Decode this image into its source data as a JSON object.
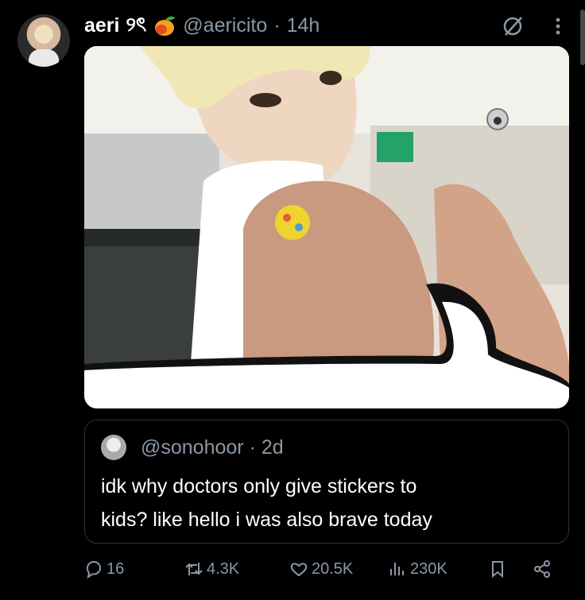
{
  "post": {
    "display_name": "aeri",
    "name_suffix": "୨ৎ",
    "handle": "@aericito",
    "separator": "·",
    "time": "14h"
  },
  "quoted": {
    "handle": "@sonohoor",
    "separator": "·",
    "time": "2d",
    "text": "idk why doctors only give stickers to\nkids? like hello i was also brave today"
  },
  "actions": {
    "replies": "16",
    "reposts": "4.3K",
    "likes": "20.5K",
    "views": "230K"
  },
  "icons": {
    "reply": "reply-icon",
    "repost": "repost-icon",
    "like": "heart-icon",
    "views": "views-icon",
    "bookmark": "bookmark-icon",
    "share": "share-icon",
    "emoji": "mango-icon"
  },
  "colors": {
    "background": "#000000",
    "muted_text": "#8b98a5",
    "primary_text": "#ffffff",
    "border": "#2f3336"
  }
}
